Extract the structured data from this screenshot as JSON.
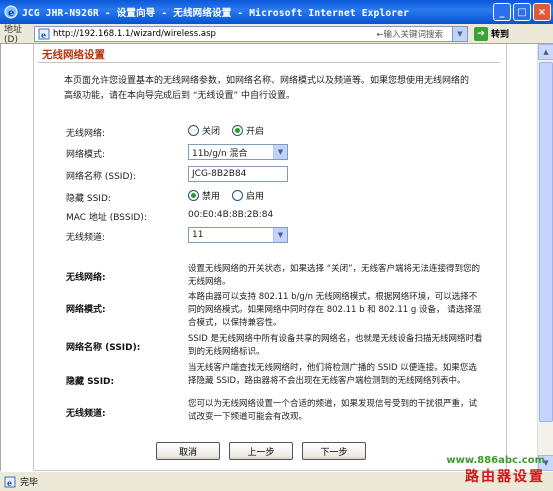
{
  "window": {
    "title": "JCG JHR-N926R - 设置向导 - 无线网络设置 - Microsoft Internet Explorer",
    "minimize": "_",
    "maximize": "□",
    "close": "×"
  },
  "addressbar": {
    "label": "地址(D)",
    "url": "http://192.168.1.1/wizard/wireless.asp",
    "search_hint": "←输入关键词搜索",
    "go_label": "转到",
    "links_label": ""
  },
  "panel": {
    "title": "无线网络设置",
    "intro": "本页面允许您设置基本的无线网络参数，如网络名称、网络模式以及频道等。如果您想使用无线网络的高级功能，请在本向导完成后到 “无线设置” 中自行设置。"
  },
  "form": {
    "wireless": {
      "label": "无线网络:",
      "off": "关闭",
      "on": "开启",
      "selected": "on"
    },
    "mode": {
      "label": "网络模式:",
      "value": "11b/g/n 混合"
    },
    "ssid": {
      "label": "网络名称 (SSID):",
      "value": "JCG-8B2B84"
    },
    "hide_ssid": {
      "label": "隐藏  SSID:",
      "disable": "禁用",
      "enable": "启用",
      "selected": "disable"
    },
    "mac": {
      "label": "MAC 地址 (BSSID):",
      "value": "00:E0:4B:8B:2B:84"
    },
    "channel": {
      "label": "无线频道:",
      "value": "11"
    }
  },
  "help": [
    {
      "label": "无线网络:",
      "text": "设置无线网络的开关状态，如果选择 “关闭”，无线客户端将无法连接得到您的无线网络。"
    },
    {
      "label": "网络模式:",
      "text": "本路由器可以支持 802.11 b/g/n 无线网络模式，根据网络环境，可以选择不同的网络模式。如果网络中同时存在 802.11 b 和 802.11 g 设备， 请选择混合模式，以保持兼容性。"
    },
    {
      "label": "网络名称 (SSID):",
      "text": "SSID 是无线网络中所有设备共享的网络名，也就是无线设备扫描无线网络时看到的无线网络标识。"
    },
    {
      "label": "隐藏  SSID:",
      "text": "当无线客户端查找无线网络时，他们将检测广播的 SSID 以便连接。如果您选择隐藏 SSID，路由器将不会出现在无线客户端检测到的无线网络列表中。"
    },
    {
      "label": "无线频道:",
      "text": "您可以为无线网络设置一个合适的频道，如果发现信号受到的干扰很严重，试试改变一下频道可能会有改观。"
    }
  ],
  "buttons": {
    "cancel": "取消",
    "prev": "上一步",
    "next": "下一步"
  },
  "status": {
    "text": "完毕"
  },
  "watermark": {
    "url": "www.886abc.com",
    "name": "路由器设置"
  },
  "colors": {
    "title_accent": "#b8360f",
    "radio_selected": "#21a121",
    "titlebar_blue": "#0a58d8"
  }
}
